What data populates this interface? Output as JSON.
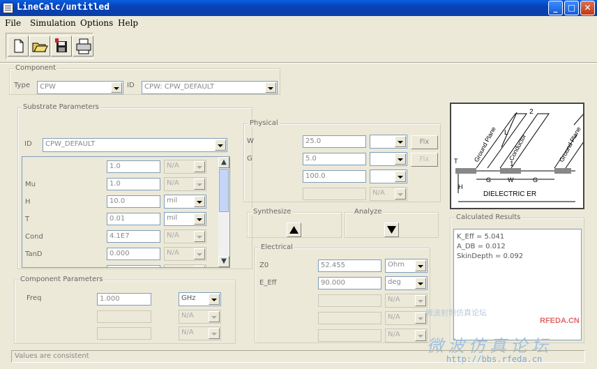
{
  "window": {
    "title": "LineCalc/untitled"
  },
  "menus": [
    "File",
    "Simulation",
    "Options",
    "Help"
  ],
  "toolbar": {
    "icons": [
      "new-file-icon",
      "open-folder-icon",
      "save-floppy-icon",
      "print-icon"
    ]
  },
  "component": {
    "group_label": "Component",
    "type_label": "Type",
    "type_value": "CPW",
    "id_label": "ID",
    "id_value": "CPW: CPW_DEFAULT"
  },
  "substrate": {
    "group_label": "Substrate Parameters",
    "id_label": "ID",
    "id_value": "CPW_DEFAULT",
    "rows": [
      {
        "label": "",
        "value": "1.0",
        "unit": "N/A"
      },
      {
        "label": "Mu",
        "value": "1.0",
        "unit": "N/A"
      },
      {
        "label": "H",
        "value": "10.0",
        "unit": "mil"
      },
      {
        "label": "T",
        "value": "0.01",
        "unit": "mil"
      },
      {
        "label": "Cond",
        "value": "4.1E7",
        "unit": "N/A"
      },
      {
        "label": "TanD",
        "value": "0.000",
        "unit": "N/A"
      },
      {
        "label": "",
        "value": "",
        "unit": ""
      }
    ]
  },
  "physical": {
    "group_label": "Physical",
    "rows": [
      {
        "label": "W",
        "value": "25.0",
        "unit": ""
      },
      {
        "label": "G",
        "value": "5.0",
        "unit": ""
      },
      {
        "label": "",
        "value": "100.0",
        "unit": ""
      },
      {
        "label": "",
        "value": "",
        "unit": "N/A"
      }
    ],
    "buttons": [
      "Fix",
      "Fix"
    ]
  },
  "synthesize": {
    "label": "Synthesize"
  },
  "analyze": {
    "label": "Analyze"
  },
  "component_params": {
    "group_label": "Component Parameters",
    "freq_label": "Freq",
    "freq_value": "1.000",
    "freq_unit": "GHz",
    "rows": [
      {
        "value": "",
        "unit": "N/A"
      },
      {
        "value": "",
        "unit": "N/A"
      }
    ]
  },
  "electrical": {
    "group_label": "Electrical",
    "rows": [
      {
        "label": "Z0",
        "value": "52.455",
        "unit": "Ohm"
      },
      {
        "label": "E_Eff",
        "value": "90.000",
        "unit": "deg"
      },
      {
        "label": "",
        "value": "",
        "unit": "N/A"
      },
      {
        "label": "",
        "value": "",
        "unit": "N/A"
      },
      {
        "label": "",
        "value": "",
        "unit": "N/A"
      }
    ]
  },
  "diagram": {
    "labels": {
      "ground1": "Ground Plane",
      "conductor": "Conductor",
      "ground2": "Ground Plane",
      "l": "L",
      "two": "2",
      "one": "1",
      "t": "T",
      "g1": "G",
      "w": "W",
      "g2": "G",
      "h": "H",
      "dielectric": "DIELECTRIC  ER"
    }
  },
  "results": {
    "group_label": "Calculated Results",
    "lines": [
      "K_Eff = 5.041",
      "A_DB = 0.012",
      "SkinDepth = 0.092"
    ]
  },
  "status": {
    "text": "Values are consistent"
  },
  "watermark": {
    "brand": "RFEDA.CN",
    "title": "微波仿真论坛",
    "url": "http://bbs.rfeda.cn",
    "tag": "微波射频仿真论坛"
  }
}
